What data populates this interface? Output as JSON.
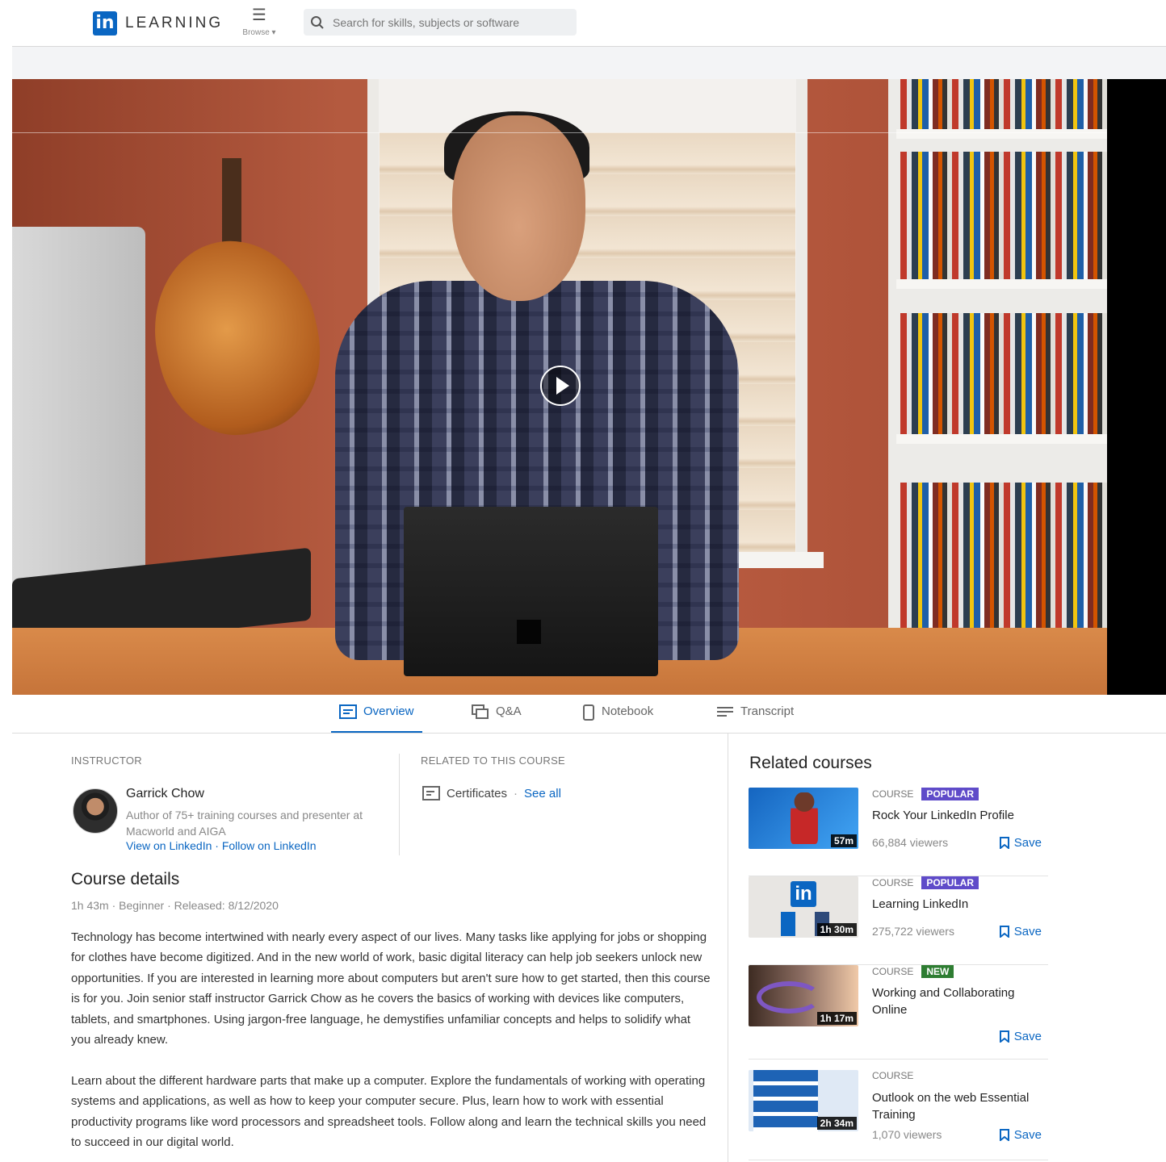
{
  "header": {
    "logo_badge": "in",
    "logo_text": "LEARNING",
    "browse_label": "Browse",
    "search_placeholder": "Search for skills, subjects or software"
  },
  "tabs": [
    {
      "label": "Overview",
      "icon": "overview-icon",
      "active": true
    },
    {
      "label": "Q&A",
      "icon": "qa-icon"
    },
    {
      "label": "Notebook",
      "icon": "notebook-icon"
    },
    {
      "label": "Transcript",
      "icon": "transcript-icon"
    }
  ],
  "instructor": {
    "section_label": "INSTRUCTOR",
    "name": "Garrick Chow",
    "bio": "Author of 75+ training courses and presenter at Macworld and AIGA",
    "view_link": "View on LinkedIn",
    "follow_link": "Follow on LinkedIn"
  },
  "related_to_course": {
    "section_label": "RELATED TO THIS COURSE",
    "item": "Certificates",
    "see_all": "See all"
  },
  "course_details": {
    "title": "Course details",
    "duration": "1h 43m",
    "level": "Beginner",
    "released": "Released: 8/12/2020",
    "paragraphs": [
      "Technology has become intertwined with nearly every aspect of our lives. Many tasks like applying for jobs or shopping for clothes have become digitized. And in the new world of work, basic digital literacy can help job seekers unlock new opportunities. If you are interested in learning more about computers but aren't sure how to get started, then this course is for you. Join senior staff instructor Garrick Chow as he covers the basics of working with devices like computers, tablets, and smartphones. Using jargon-free language, he demystifies unfamiliar concepts and helps to solidify what you already knew.",
      "Learn about the different hardware parts that make up a computer. Explore the fundamentals of working with operating systems and applications, as well as how to keep your computer secure. Plus, learn how to work with essential productivity programs like word processors and spreadsheet tools. Follow along and learn the technical skills you need to succeed in our digital world."
    ]
  },
  "related_courses": {
    "title": "Related courses",
    "items": [
      {
        "type": "COURSE",
        "badge": "POPULAR",
        "badge_color": "#5f4bc9",
        "title": "Rock Your LinkedIn Profile",
        "viewers": "66,884 viewers",
        "duration": "57m",
        "save": "Save"
      },
      {
        "type": "COURSE",
        "badge": "POPULAR",
        "badge_color": "#5f4bc9",
        "title": "Learning LinkedIn",
        "viewers": "275,722 viewers",
        "duration": "1h 30m",
        "save": "Save"
      },
      {
        "type": "COURSE",
        "badge": "NEW",
        "badge_color": "#2e7d32",
        "title": "Working and Collaborating Online",
        "viewers": "",
        "duration": "1h 17m",
        "save": "Save"
      },
      {
        "type": "COURSE",
        "badge": "",
        "badge_color": "",
        "title": "Outlook on the web Essential Training",
        "viewers": "1,070 viewers",
        "duration": "2h 34m",
        "save": "Save"
      }
    ]
  },
  "colors": {
    "accent": "#0a66c2"
  }
}
